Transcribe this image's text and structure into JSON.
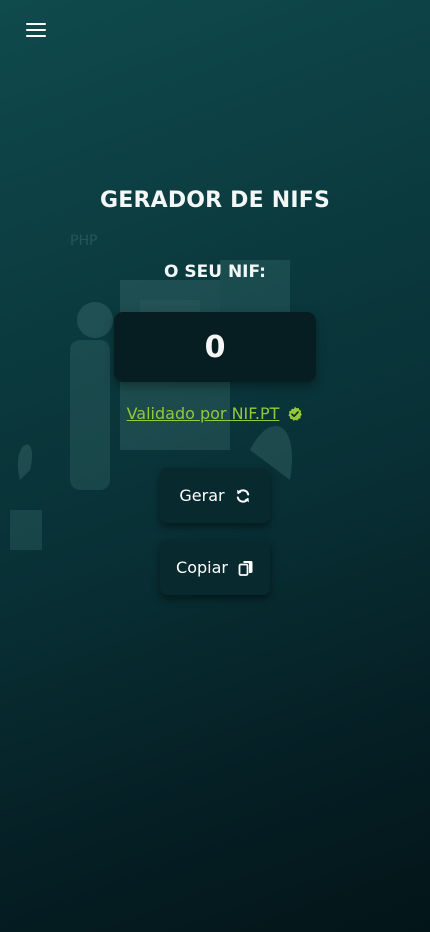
{
  "header": {
    "menu_icon": "hamburger-menu-icon"
  },
  "main": {
    "title": "GERADOR DE NIFS",
    "subtitle": "O SEU NIF:",
    "nif_value": "0",
    "validated_link": "Validado por NIF.PT",
    "validated_icon": "check-badge-icon"
  },
  "actions": {
    "generate_label": "Gerar",
    "generate_icon": "refresh-icon",
    "copy_label": "Copiar",
    "copy_icon": "copy-icon"
  },
  "colors": {
    "link": "#93c83a",
    "button_bg": "#08292d",
    "nif_box_bg": "#061e22"
  }
}
